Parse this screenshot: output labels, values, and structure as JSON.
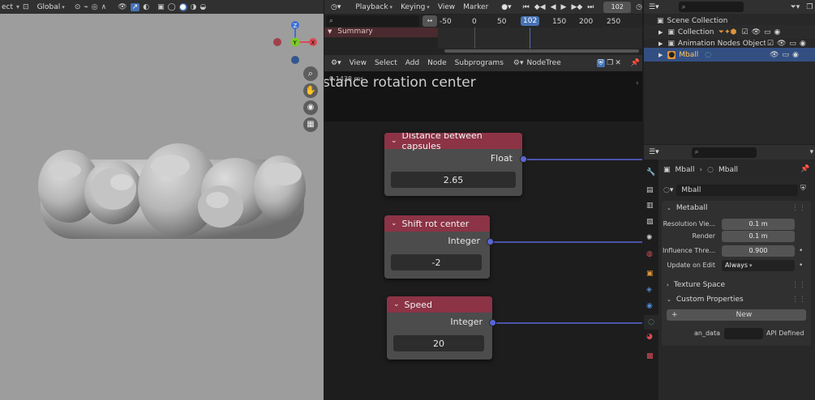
{
  "viewport_header": {
    "mode_label": "ect",
    "transform_label": "Global"
  },
  "timeline": {
    "search_placeholder": "",
    "menu": [
      "Playback",
      "Keying",
      "View",
      "Marker"
    ],
    "current_frame": "102",
    "ruler": [
      "-50",
      "0",
      "50",
      "102",
      "150",
      "200",
      "250"
    ],
    "summary_label": "Summary"
  },
  "node_editor": {
    "menu": [
      "View",
      "Select",
      "Add",
      "Node",
      "Subprograms"
    ],
    "tree_name": "NodeTree",
    "timing_text": "0.1438 ms",
    "frame_title": "stance rotation center",
    "nodes": [
      {
        "title": "Distance between capsules",
        "output": "Float",
        "value": "2.65"
      },
      {
        "title": "Shift rot center",
        "output": "Integer",
        "value": "-2"
      },
      {
        "title": "Speed",
        "output": "Integer",
        "value": "20"
      }
    ]
  },
  "outliner": {
    "search_placeholder": "",
    "items": [
      {
        "label": "Scene Collection"
      },
      {
        "label": "Collection"
      },
      {
        "label": "Animation Nodes Object Con"
      },
      {
        "label": "Mball"
      }
    ]
  },
  "properties": {
    "breadcrumb": [
      "Mball",
      "Mball"
    ],
    "data_name": "Mball",
    "metaball_header": "Metaball",
    "fields": [
      {
        "label": "Resolution Vie...",
        "value": "0.1 m"
      },
      {
        "label": "Render",
        "value": "0.1 m"
      },
      {
        "label": "Influence Thre...",
        "value": "0.900"
      },
      {
        "label": "Update on Edit",
        "value": "Always"
      }
    ],
    "texture_space": "Texture Space",
    "custom_props": "Custom Properties",
    "new_button": "New",
    "an_data_label": "an_data",
    "api_defined": "API Defined"
  },
  "colors": {
    "node_header": "#8c3346",
    "socket": "#5a66d8",
    "selected_row": "#334f82",
    "accent": "#4772b3"
  }
}
